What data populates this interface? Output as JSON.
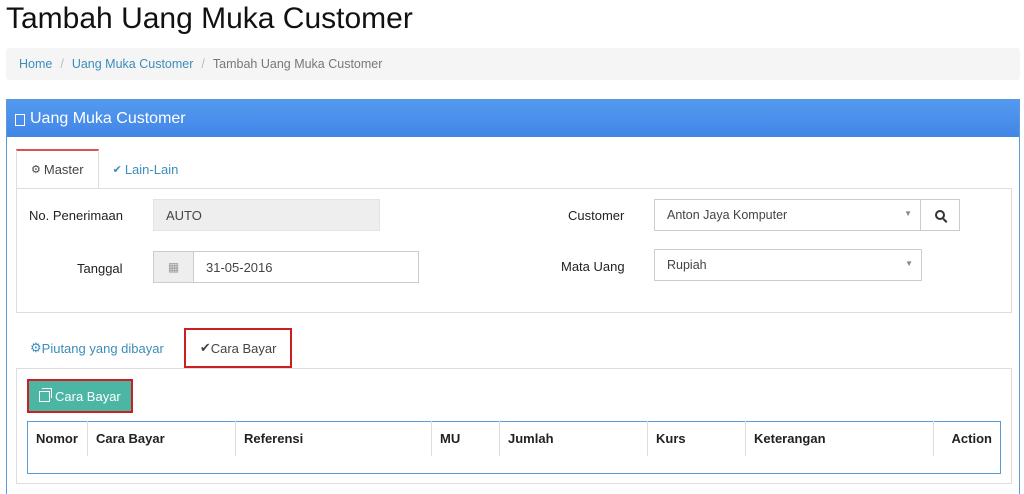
{
  "page": {
    "title": "Tambah Uang Muka Customer"
  },
  "breadcrumb": {
    "home": "Home",
    "parent": "Uang Muka Customer",
    "current": "Tambah Uang Muka Customer",
    "separator": "/"
  },
  "panel": {
    "title": "Uang Muka Customer"
  },
  "tabs_top": [
    {
      "label": "Master",
      "icon": "cogs-icon",
      "active": true
    },
    {
      "label": "Lain-Lain",
      "icon": "check-circle-icon",
      "active": false
    }
  ],
  "form": {
    "no_penerimaan": {
      "label": "No. Penerimaan",
      "value": "AUTO"
    },
    "tanggal": {
      "label": "Tanggal",
      "value": "31-05-2016",
      "icon": "calendar-icon"
    },
    "customer": {
      "label": "Customer",
      "value": "Anton Jaya Komputer"
    },
    "mata_uang": {
      "label": "Mata Uang",
      "value": "Rupiah"
    }
  },
  "tabs_bottom": [
    {
      "label": "Piutang yang dibayar",
      "icon": "cogs-icon",
      "active": false
    },
    {
      "label": "Cara Bayar",
      "icon": "check-circle-icon",
      "active": true
    }
  ],
  "actions": {
    "add_cara_bayar": "Cara Bayar"
  },
  "table": {
    "columns": [
      "Nomor",
      "Cara Bayar",
      "Referensi",
      "MU",
      "Jumlah",
      "Kurs",
      "Keterangan",
      "Action"
    ]
  },
  "colors": {
    "accent": "#4a90e2",
    "link": "#3c8dbc",
    "button": "#4cb6a5",
    "highlight": "#cc1f1f"
  }
}
